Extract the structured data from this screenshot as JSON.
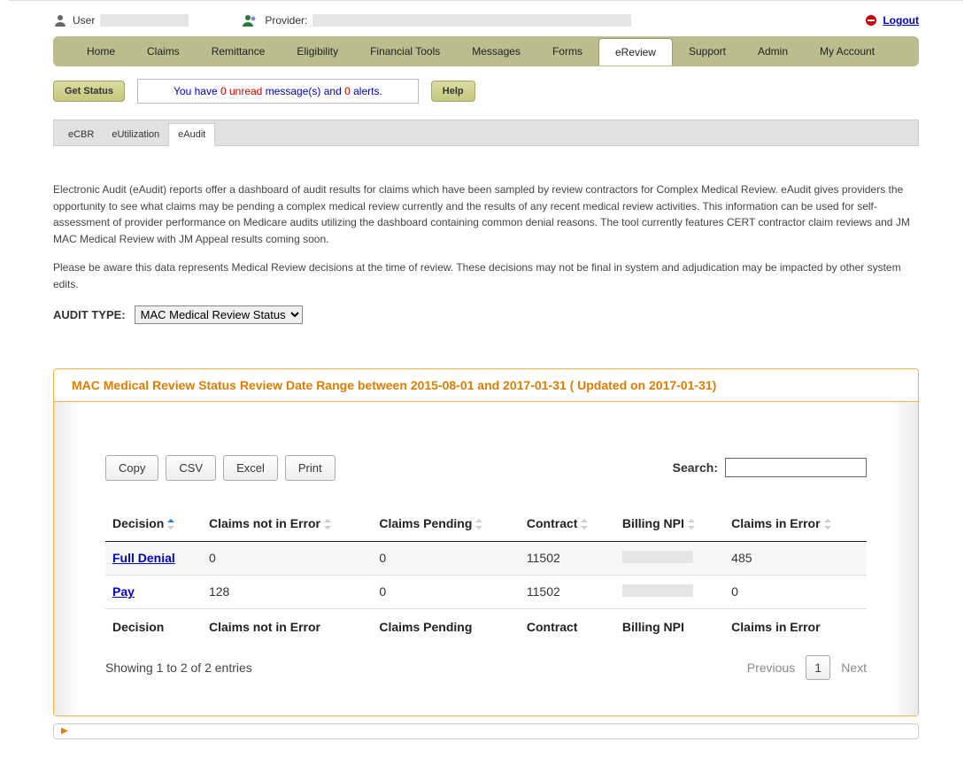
{
  "topbar": {
    "user_label": "User",
    "provider_label": "Provider:",
    "logout": "Logout"
  },
  "nav": [
    "Home",
    "Claims",
    "Remittance",
    "Eligibility",
    "Financial Tools",
    "Messages",
    "Forms",
    "eReview",
    "Support",
    "Admin",
    "My Account"
  ],
  "nav_active": "eReview",
  "statusrow": {
    "get_status": "Get Status",
    "msg_pre": "You have ",
    "msg_unread_count": "0",
    "msg_mid1": " unread ",
    "msg_mid2": "message(s) and ",
    "msg_alert_count": "0",
    "msg_post": " alerts.",
    "help": "Help"
  },
  "subtabs": [
    "eCBR",
    "eUtilization",
    "eAudit"
  ],
  "subtab_active": "eAudit",
  "body": {
    "p1": "Electronic Audit (eAudit) reports offer a dashboard of audit results for claims which have been sampled by review contractors for Complex Medical Review. eAudit gives providers the opportunity to see what claims may be pending a complex medical review currently and the results of any recent medical review activities. This information can be used for self-assessment of provider performance on Medicare audits utilizing the dashboard containing common denial reasons. The tool currently features CERT contractor claim reviews and JM MAC Medical Review with JM Appeal results coming soon.",
    "p2": "Please be aware this data represents Medical Review decisions at the time of review. These decisions may not be final in system and adjudication may be impacted by other system edits."
  },
  "audit": {
    "label": "AUDIT TYPE:",
    "selected": "MAC Medical Review Status"
  },
  "panel": {
    "title": "MAC Medical Review Status Review Date Range between 2015-08-01 and 2017-01-31 ( Updated on 2017-01-31)"
  },
  "dt": {
    "buttons": {
      "copy": "Copy",
      "csv": "CSV",
      "excel": "Excel",
      "print": "Print"
    },
    "search_label": "Search:",
    "columns": [
      "Decision",
      "Claims not in Error",
      "Claims Pending",
      "Contract",
      "Billing NPI",
      "Claims in Error"
    ],
    "rows": [
      {
        "decision": "Full Denial",
        "not_err": "0",
        "pending": "0",
        "contract": "11502",
        "npi": "",
        "in_err": "485"
      },
      {
        "decision": "Pay",
        "not_err": "128",
        "pending": "0",
        "contract": "11502",
        "npi": "",
        "in_err": "0"
      }
    ],
    "info": "Showing 1 to 2 of 2 entries",
    "pager": {
      "prev": "Previous",
      "page": "1",
      "next": "Next"
    }
  }
}
